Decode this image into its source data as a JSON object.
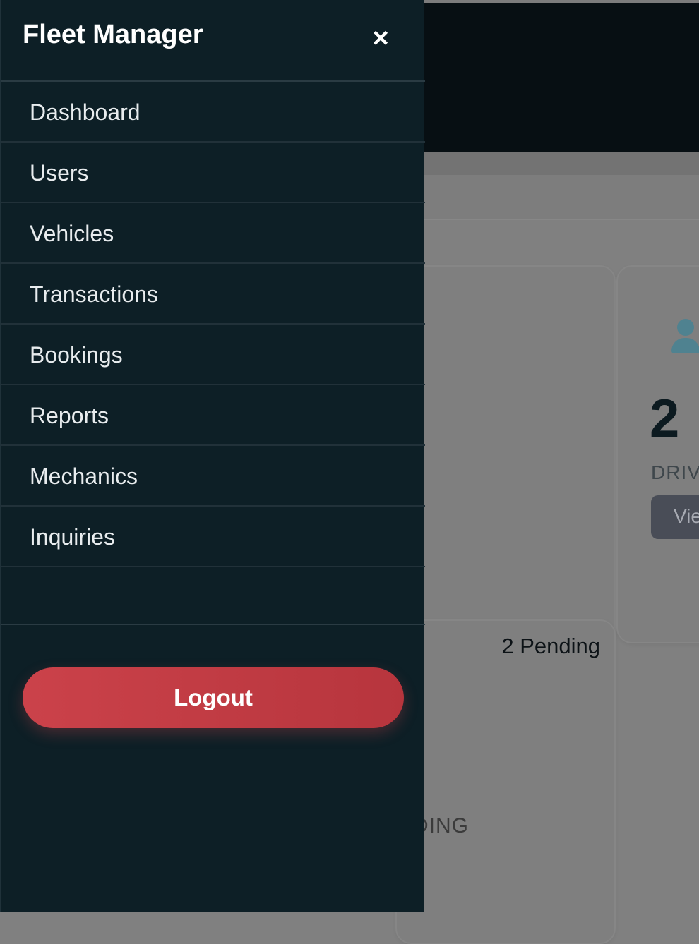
{
  "drawer": {
    "title": "Fleet Manager",
    "close_icon": "close-icon",
    "close_glyph": "×",
    "nav_items": [
      {
        "label": "Dashboard"
      },
      {
        "label": "Users"
      },
      {
        "label": "Vehicles"
      },
      {
        "label": "Transactions"
      },
      {
        "label": "Bookings"
      },
      {
        "label": "Reports"
      },
      {
        "label": "Mechanics"
      },
      {
        "label": "Inquiries"
      }
    ],
    "logout_label": "Logout",
    "colors": {
      "background": "#0d1f26",
      "logout": "#c43d45",
      "text": "#ffffff"
    }
  },
  "background": {
    "driver_card": {
      "icon": "user-icon",
      "count": "2",
      "label_partial": "DRIV",
      "button_partial": "Vie"
    },
    "pending_card": {
      "status": "2 Pending",
      "caption_partial": "DING"
    },
    "colors": {
      "overlay": "#808080",
      "accent_icon": "#4f8290"
    }
  }
}
